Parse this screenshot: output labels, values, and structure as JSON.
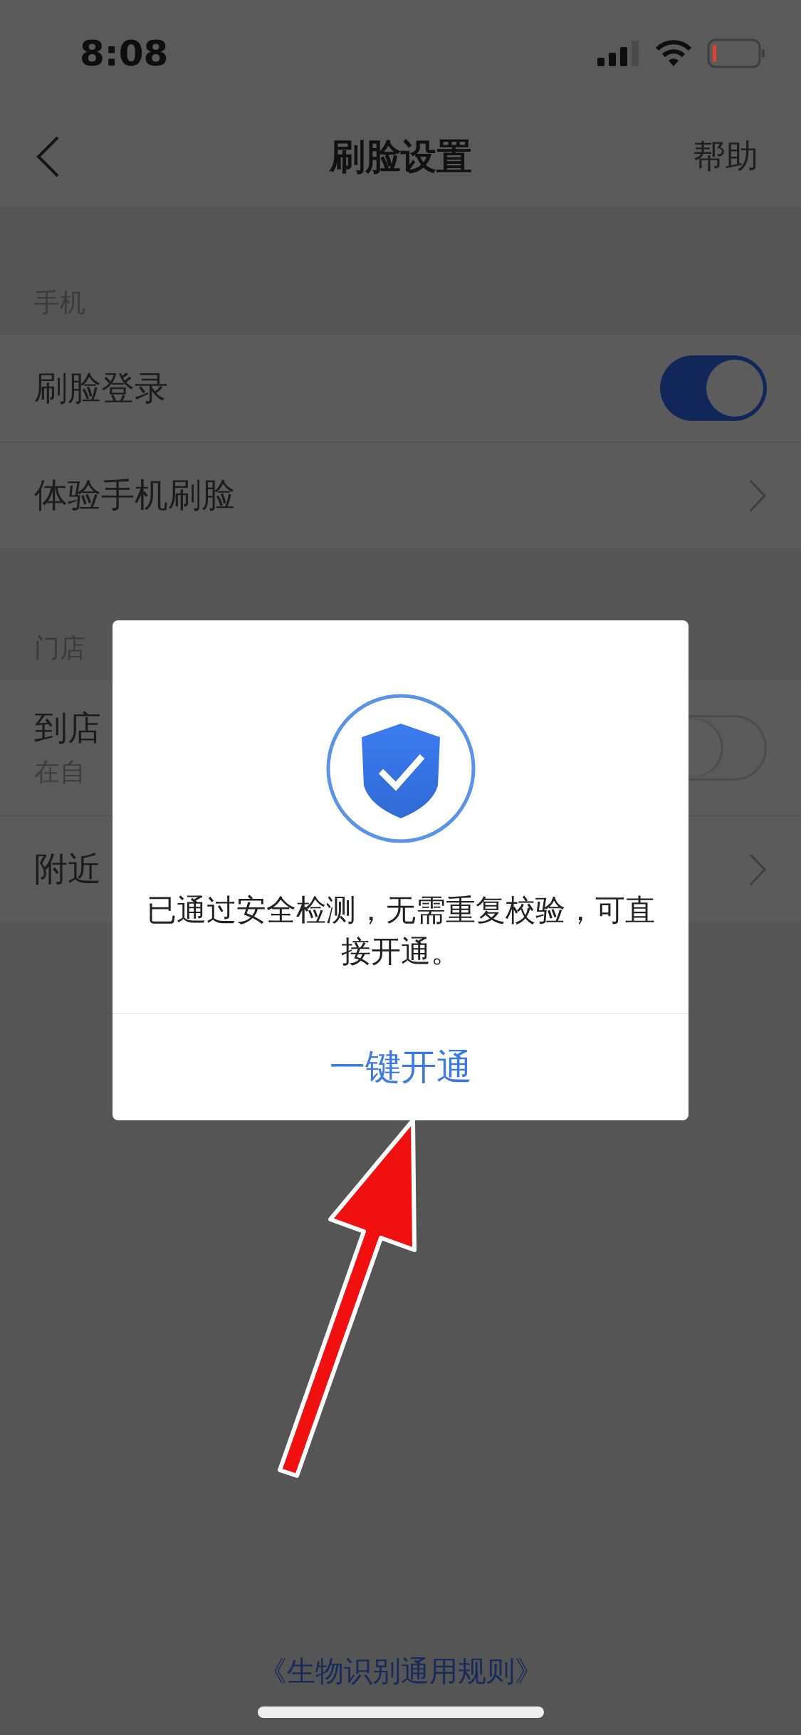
{
  "status_bar": {
    "time": "8:08"
  },
  "nav": {
    "title": "刷脸设置",
    "action": "帮助"
  },
  "sections": [
    {
      "header": "手机",
      "rows": [
        {
          "kind": "toggle",
          "label": "刷脸登录",
          "on": true
        },
        {
          "kind": "link",
          "label": "体验手机刷脸"
        }
      ]
    },
    {
      "header": "门店",
      "rows": [
        {
          "kind": "toggle",
          "label": "到店",
          "subtitle": "在自",
          "on": false
        },
        {
          "kind": "link",
          "label": "附近"
        }
      ]
    }
  ],
  "dialog": {
    "message": "已通过安全检测，无需重复校验，可直接开通。",
    "button": "一键开通"
  },
  "footer_link": "《生物识别通用规则》"
}
